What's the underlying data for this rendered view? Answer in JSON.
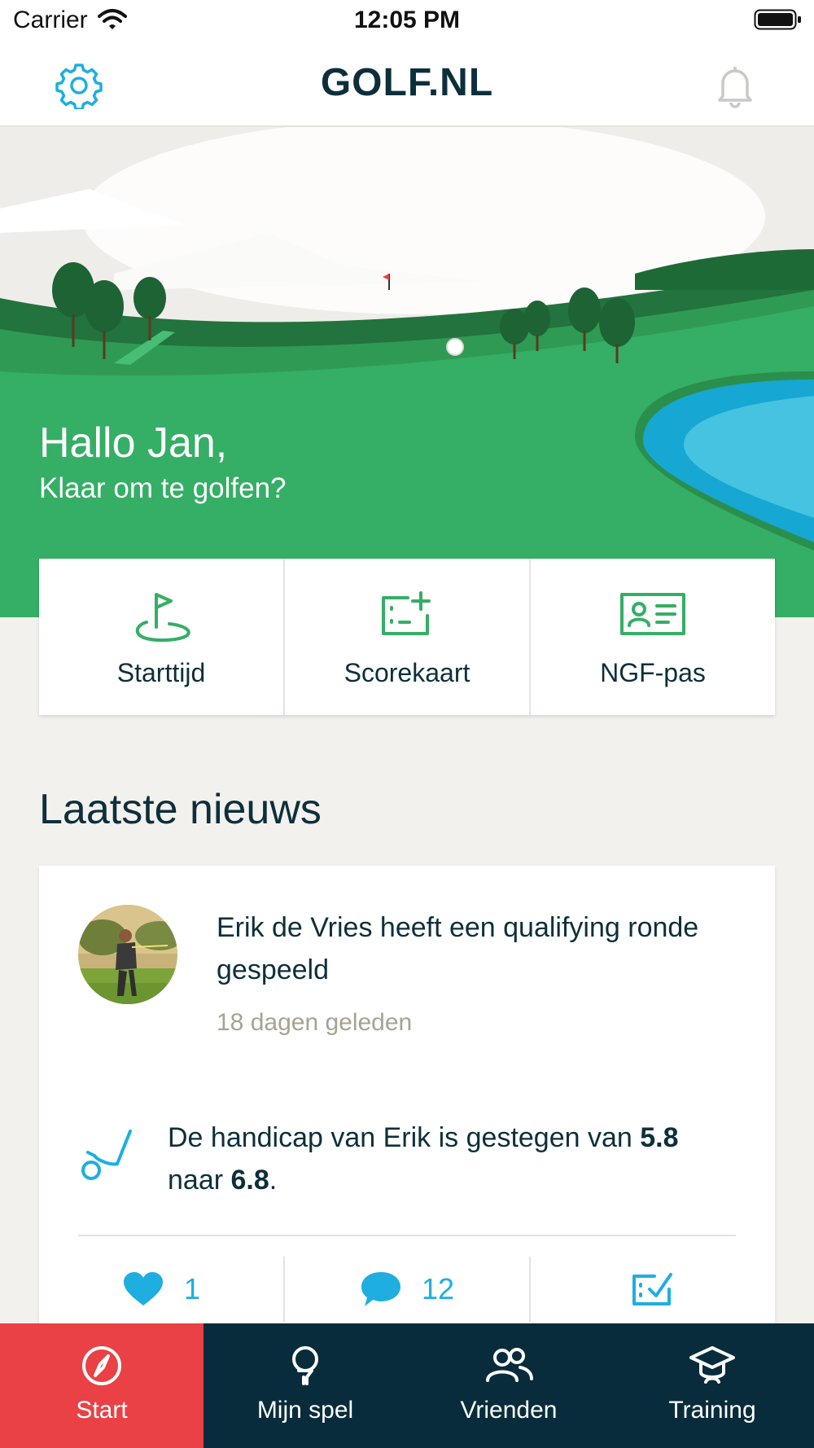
{
  "status_bar": {
    "carrier": "Carrier",
    "time": "12:05 PM"
  },
  "header": {
    "logo": "GOLF.NL",
    "settings_icon": "gear-icon",
    "notifications_icon": "bell-icon"
  },
  "hero": {
    "greeting": "Hallo Jan,",
    "subtitle": "Klaar om te golfen?"
  },
  "quick_actions": [
    {
      "label": "Starttijd",
      "icon": "flag-green-icon"
    },
    {
      "label": "Scorekaart",
      "icon": "scorecard-add-icon"
    },
    {
      "label": "NGF-pas",
      "icon": "id-card-icon"
    }
  ],
  "news": {
    "title": "Laatste nieuws",
    "item": {
      "headline": "Erik de Vries heeft een qualifying ronde gespeeld",
      "time": "18 dagen geleden",
      "handicap_prefix": "De handicap van Erik is gestegen van ",
      "handicap_from": "5.8",
      "handicap_middle": " naar ",
      "handicap_to": "6.8",
      "handicap_suffix": ".",
      "likes": "1",
      "comments": "12"
    }
  },
  "tabbar": {
    "active": "Start",
    "tabs": [
      {
        "label": "Start",
        "icon": "compass-icon"
      },
      {
        "label": "Mijn spel",
        "icon": "golf-ball-tee-icon"
      },
      {
        "label": "Vrienden",
        "icon": "friends-icon"
      },
      {
        "label": "Training",
        "icon": "graduation-cap-icon"
      }
    ]
  },
  "colors": {
    "brand_green": "#35ae66",
    "accent_blue": "#1eaee0",
    "navy": "#0d2f3c",
    "active_tab_red": "#e94145",
    "tabbar_bg": "#082c3b"
  }
}
